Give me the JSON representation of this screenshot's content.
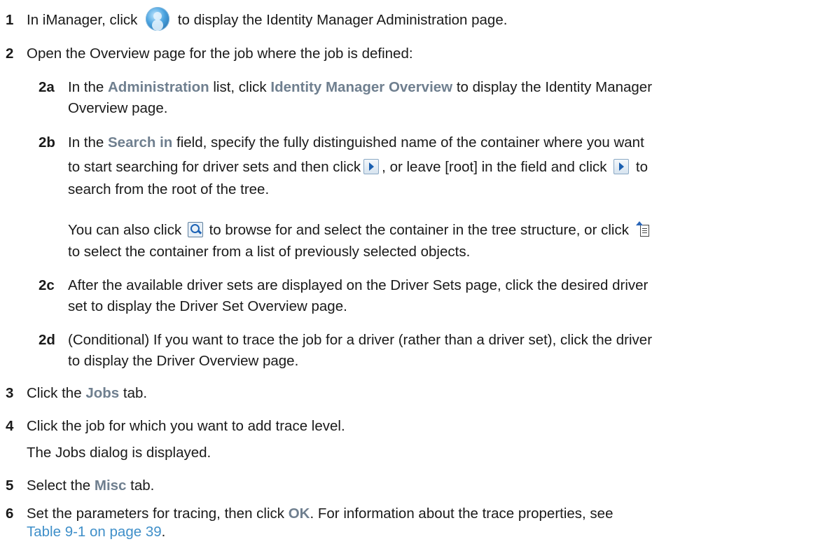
{
  "steps": {
    "s1": {
      "num": "1",
      "pre": "In iManager, click",
      "post": "to display the Identity Manager Administration page.",
      "icon": "identity-manager-icon"
    },
    "s2": {
      "num": "2",
      "text": "Open the Overview page for the job where the job is defined:"
    },
    "s2a": {
      "num": "2a",
      "pre": "In the",
      "ui1": "Administration",
      "mid": "list, click",
      "ui2": "Identity Manager Overview",
      "post": "to display the Identity Manager",
      "line2": "Overview page."
    },
    "s2b": {
      "num": "2b",
      "pre": "In the",
      "ui1": "Search in",
      "post": "field, specify the fully distinguished name of the container where you want",
      "l2a": "to start searching for driver sets and then click",
      "l2b": ", or leave [root] in the field and click",
      "l2c": "to",
      "line3": "search from the root of the tree.",
      "p2a": "You can also click",
      "p2b": "to browse for and select the container in the tree structure, or click",
      "p2line2": "to select the container from a list of previously selected objects."
    },
    "s2c": {
      "num": "2c",
      "line1": "After the available driver sets are displayed on the Driver Sets page, click the desired driver",
      "line2": "set to display the Driver Set Overview page."
    },
    "s2d": {
      "num": "2d",
      "line1": "(Conditional) If you want to trace the job for a driver (rather than a driver set), click the driver",
      "line2": "to display the Driver Overview page."
    },
    "s3": {
      "num": "3",
      "pre": "Click the",
      "ui": "Jobs",
      "post": "tab."
    },
    "s4": {
      "num": "4",
      "text": "Click the job for which you want to add trace level.",
      "line2": "The Jobs dialog is displayed."
    },
    "s5": {
      "num": "5",
      "pre": "Select the",
      "ui": "Misc",
      "post": "tab."
    },
    "s6": {
      "num": "6",
      "pre": "Set the parameters for tracing, then click",
      "ui": "OK",
      "post": ". For information about the trace properties, see",
      "link": "Table 9-1 on page 39",
      "end": "."
    }
  },
  "colors": {
    "ui_text": "#6f7f8f",
    "link": "#3f8fc9",
    "body_text": "#1a1a1a"
  },
  "icons": [
    "identity-manager-icon",
    "go-arrow-icon",
    "search-browse-icon",
    "history-list-icon"
  ]
}
